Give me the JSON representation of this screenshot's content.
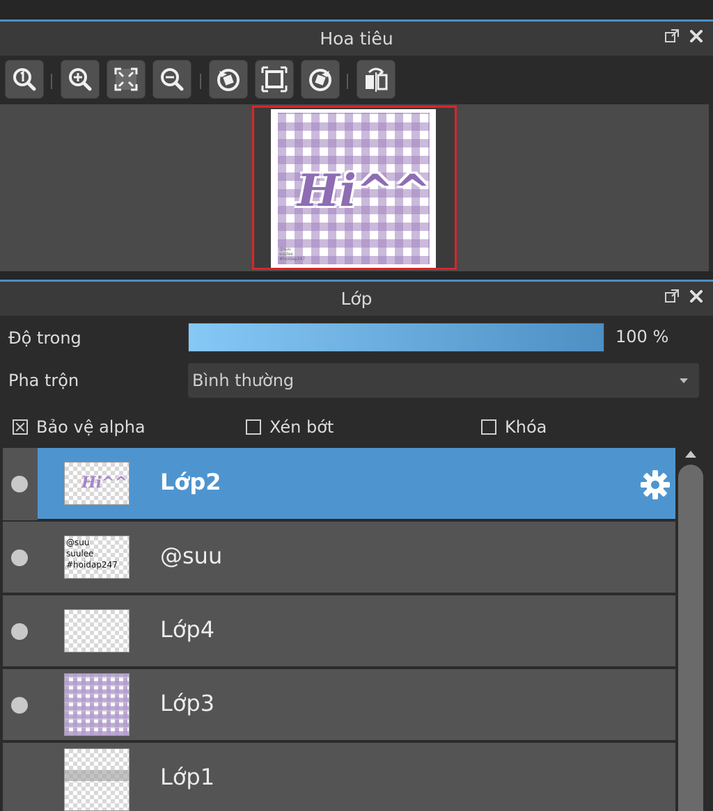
{
  "navigator": {
    "title": "Hoa tiêu",
    "toolbar": [
      {
        "name": "zoom-actual-size-button",
        "icon": "zoom-1-icon"
      },
      {
        "name": "zoom-in-button",
        "icon": "zoom-in-icon"
      },
      {
        "name": "fit-window-button",
        "icon": "fit-screen-icon"
      },
      {
        "name": "zoom-out-button",
        "icon": "zoom-out-icon"
      },
      {
        "name": "rotate-left-button",
        "icon": "rotate-left-icon"
      },
      {
        "name": "fit-canvas-button",
        "icon": "fit-canvas-icon"
      },
      {
        "name": "rotate-right-button",
        "icon": "rotate-right-icon"
      },
      {
        "name": "flip-horizontal-button",
        "icon": "flip-icon"
      }
    ],
    "preview_text": "Hi^^",
    "preview_marks": [
      "@suu",
      "suulee",
      "#hoidap247"
    ]
  },
  "layers": {
    "title": "Lớp",
    "opacity_label": "Độ trong",
    "opacity_value": "100 %",
    "opacity_fraction": 1.0,
    "blend_label": "Pha trộn",
    "blend_value": "Bình thường",
    "checkboxes": {
      "protect_alpha": {
        "label": "Bảo vệ alpha",
        "checked": true
      },
      "clipping": {
        "label": "Xén bớt",
        "checked": false
      },
      "lock": {
        "label": "Khóa",
        "checked": false
      }
    },
    "items": [
      {
        "name": "Lớp2",
        "selected": true,
        "visible": true,
        "thumb_text": "Hi^^"
      },
      {
        "name": "@suu",
        "selected": false,
        "visible": true,
        "thumb_lines": [
          "@suu",
          "suulee",
          "#hoidap247"
        ]
      },
      {
        "name": "Lớp4",
        "selected": false,
        "visible": true
      },
      {
        "name": "Lớp3",
        "selected": false,
        "visible": true
      },
      {
        "name": "Lớp1",
        "selected": false,
        "visible": false
      }
    ]
  },
  "colors": {
    "accent_blue": "#4e95cf",
    "frame_red": "#d8262b",
    "opacity_start": "#86c8f6",
    "opacity_end": "#4e8fc4"
  }
}
